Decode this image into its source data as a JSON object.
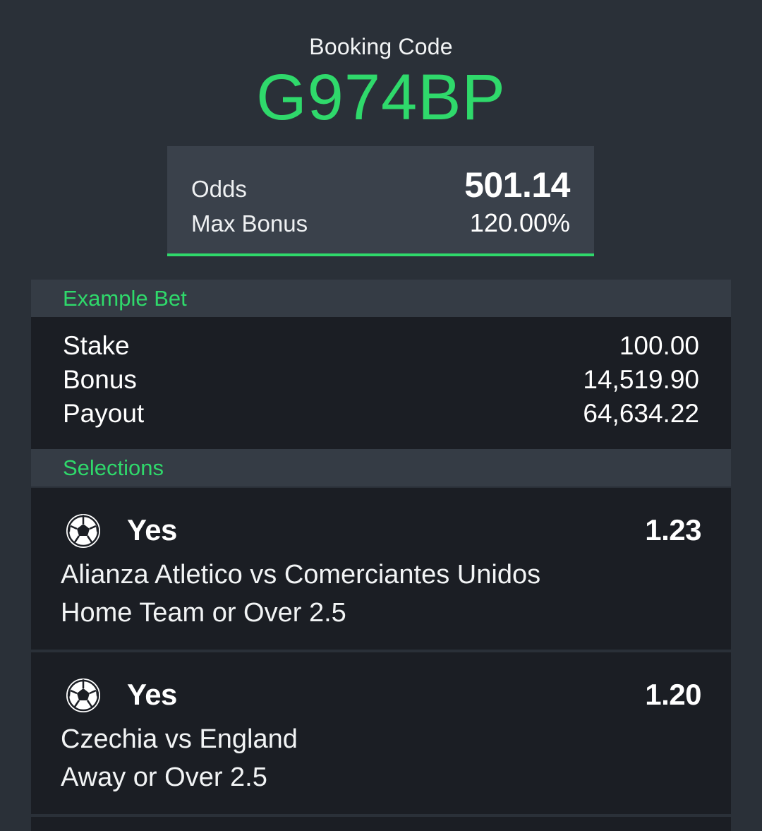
{
  "booking": {
    "label": "Booking Code",
    "code": "G974BP"
  },
  "summary": {
    "odds_label": "Odds",
    "odds_value": "501.14",
    "max_bonus_label": "Max Bonus",
    "max_bonus_value": "120.00%"
  },
  "example_bet": {
    "title": "Example Bet",
    "stake_label": "Stake",
    "stake_value": "100.00",
    "bonus_label": "Bonus",
    "bonus_value": "14,519.90",
    "payout_label": "Payout",
    "payout_value": "64,634.22"
  },
  "selections": {
    "title": "Selections",
    "items": [
      {
        "icon": "soccer-ball-icon",
        "pick": "Yes",
        "odds": "1.23",
        "match": "Alianza Atletico vs Comerciantes Unidos",
        "market": "Home Team or Over 2.5"
      },
      {
        "icon": "soccer-ball-icon",
        "pick": "Yes",
        "odds": "1.20",
        "match": "Czechia vs England",
        "market": "Away or Over 2.5"
      }
    ]
  },
  "colors": {
    "background": "#2a3038",
    "accent_green": "#2fd96b",
    "card_dark": "#1b1e24",
    "section_header": "#353c45",
    "summary_box": "#3a414b"
  }
}
